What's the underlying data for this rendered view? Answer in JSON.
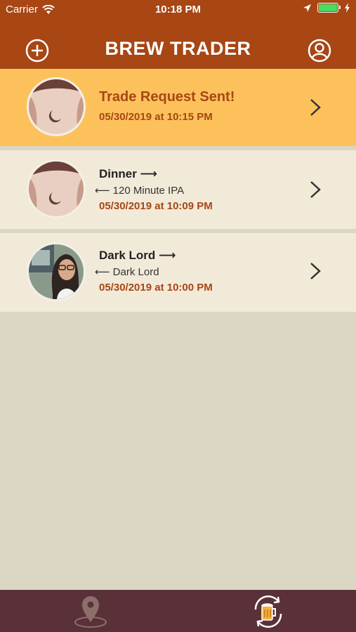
{
  "status_bar": {
    "carrier": "Carrier",
    "time": "10:18 PM",
    "battery_level": 1.0
  },
  "header": {
    "title": "BREW TRADER",
    "left_icon": "add-circle-icon",
    "right_icon": "profile-icon"
  },
  "colors": {
    "header_bg": "#a84614",
    "highlight_bg": "#fdc15c",
    "row_bg": "#f2ead9",
    "accent_text": "#a84614",
    "tabbar_bg": "#5a3138",
    "page_bg": "#dcd7c4"
  },
  "trades": [
    {
      "title": "Trade Request Sent!",
      "timestamp": "05/30/2019 at 10:15 PM",
      "highlighted": true,
      "avatar": "tattoo-photo"
    },
    {
      "title": "Dinner ⟶",
      "received": "⟵ 120 Minute IPA",
      "timestamp": "05/30/2019 at 10:09 PM",
      "avatar": "tattoo-photo"
    },
    {
      "title": "Dark Lord ⟶",
      "received": "⟵ Dark Lord",
      "timestamp": "05/30/2019 at 10:00 PM",
      "avatar": "woman-glasses-photo"
    }
  ],
  "tabbar": {
    "items": [
      {
        "icon": "map-pin-icon",
        "selected": false
      },
      {
        "icon": "beer-trade-icon",
        "selected": true
      }
    ]
  }
}
